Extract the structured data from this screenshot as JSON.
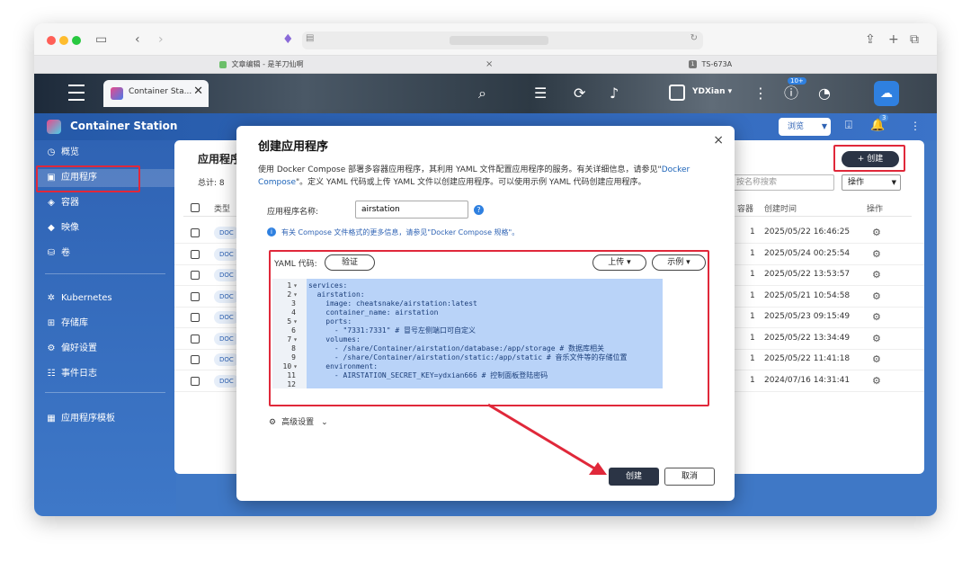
{
  "browser": {
    "tabs": [
      {
        "label": "文章编辑 - 是羊刀仙啊"
      },
      {
        "label": "TS-673A"
      }
    ]
  },
  "qnap": {
    "app_tab_label": "Container Sta...",
    "notify_badge": "10+",
    "user_name": "YDXian ▾"
  },
  "app": {
    "title": "Container Station",
    "browse_label": "浏览",
    "badge_count": "3",
    "nav": [
      {
        "label": "概览",
        "icon": "gauge-icon"
      },
      {
        "label": "应用程序",
        "icon": "layers-icon"
      },
      {
        "label": "容器",
        "icon": "cube-icon"
      },
      {
        "label": "映像",
        "icon": "stack-icon"
      },
      {
        "label": "卷",
        "icon": "database-icon"
      },
      {
        "label": "Kubernetes",
        "icon": "kubernetes-icon"
      },
      {
        "label": "存储库",
        "icon": "repository-icon"
      },
      {
        "label": "偏好设置",
        "icon": "gear-icon"
      },
      {
        "label": "事件日志",
        "icon": "log-icon"
      },
      {
        "label": "应用程序模板",
        "icon": "template-icon"
      }
    ],
    "collapse": "«"
  },
  "panel": {
    "title": "应用程序",
    "total": "总计: 8",
    "create_label": "+ 创建",
    "search_placeholder": "按名称搜索",
    "action_label": "操作",
    "columns": {
      "type": "类型",
      "containers": "容器",
      "created": "创建时间",
      "ops": "操作"
    },
    "rows": [
      {
        "type": "DOC",
        "containers": "1",
        "created": "2025/05/22 16:46:25"
      },
      {
        "type": "DOC",
        "containers": "1",
        "created": "2025/05/24 00:25:54"
      },
      {
        "type": "DOC",
        "containers": "1",
        "created": "2025/05/22 13:53:57"
      },
      {
        "type": "DOC",
        "containers": "1",
        "created": "2025/05/21 10:54:58"
      },
      {
        "type": "DOC",
        "containers": "1",
        "created": "2025/05/23 09:15:49"
      },
      {
        "type": "DOC",
        "containers": "1",
        "created": "2025/05/22 13:34:49"
      },
      {
        "type": "DOC",
        "containers": "1",
        "created": "2025/05/22 11:41:18"
      },
      {
        "type": "DOC",
        "containers": "1",
        "created": "2024/07/16 14:31:41"
      }
    ]
  },
  "modal": {
    "title": "创建应用程序",
    "close": "×",
    "desc_line1": "使用 Docker Compose 部署多容器应用程序，其利用 YAML 文件配置应用程序的服务。有关详细信息，请参见\"",
    "desc_link": "Docker",
    "desc_line2_link": "Compose",
    "desc_line2": "\"。定义 YAML 代码或上传 YAML 文件以创建应用程序。可以使用示例 YAML 代码创建应用程序。",
    "name_label": "应用程序名称:",
    "name_value": "airstation",
    "info_text": "有关 Compose 文件格式的更多信息，请参见\"Docker Compose 规格\"。",
    "yaml_label": "YAML 代码:",
    "validate_label": "验证",
    "upload_label": "上传 ▾",
    "example_label": "示例 ▾",
    "code_lines": [
      {
        "n": "1",
        "fold": "▾",
        "text": "services:"
      },
      {
        "n": "2",
        "fold": "▾",
        "text": "  airstation:"
      },
      {
        "n": "3",
        "fold": "",
        "text": "    image: cheatsnake/airstation:latest"
      },
      {
        "n": "4",
        "fold": "",
        "text": "    container_name: airstation"
      },
      {
        "n": "5",
        "fold": "▾",
        "text": "    ports:"
      },
      {
        "n": "6",
        "fold": "",
        "text": "      - \"7331:7331\" # 冒号左侧端口可自定义"
      },
      {
        "n": "7",
        "fold": "▾",
        "text": "    volumes:"
      },
      {
        "n": "8",
        "fold": "",
        "text": "      - /share/Container/airstation/database:/app/storage # 数据库相关"
      },
      {
        "n": "9",
        "fold": "",
        "text": "      - /share/Container/airstation/static:/app/static # 音乐文件等的存储位置"
      },
      {
        "n": "10",
        "fold": "▾",
        "text": "    environment:"
      },
      {
        "n": "11",
        "fold": "",
        "text": "      - AIRSTATION_SECRET_KEY=ydxian666 # 控制面板登陆密码"
      },
      {
        "n": "12",
        "fold": "",
        "text": ""
      }
    ],
    "advanced_label": "高级设置",
    "create_label": "创建",
    "cancel_label": "取消"
  },
  "colors": {
    "accent": "#2f63b4",
    "annotation_red": "#e0283a",
    "dark_button": "#2b3445"
  }
}
